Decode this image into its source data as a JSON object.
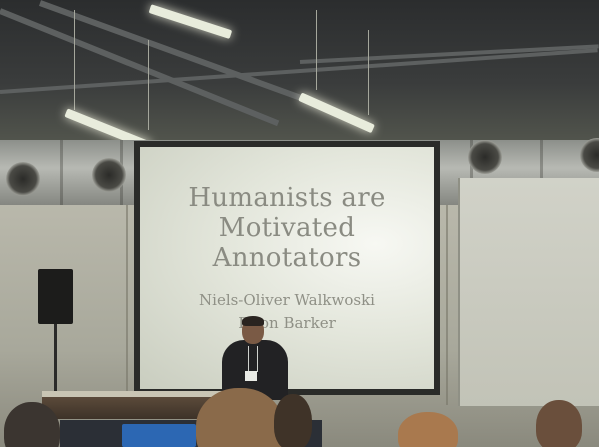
{
  "slide": {
    "title_lines": [
      "Humanists are",
      "Motivated",
      "Annotators"
    ],
    "author_lines": [
      "Niels-Oliver Walkwoski",
      "Elton Barker"
    ]
  },
  "colors": {
    "slide_text": "#8a8b82",
    "screen_face": "#e3e6db",
    "ceiling": "#2b2d2e",
    "wall": "#b9b8ab",
    "lectern_logo": "#2c67b3"
  }
}
